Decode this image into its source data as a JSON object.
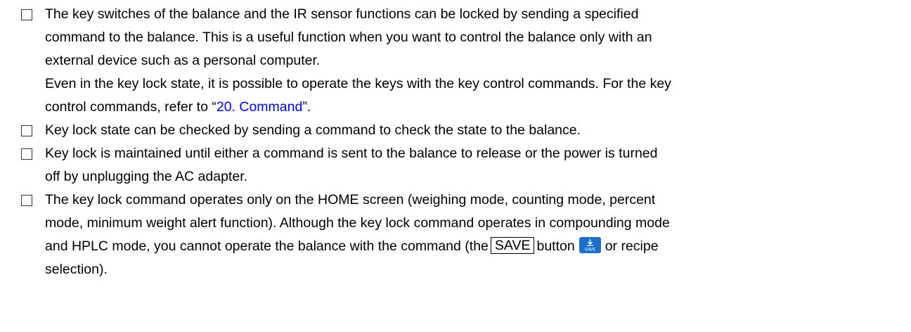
{
  "items": [
    {
      "lines": [
        "The key switches of the balance and the IR sensor functions can be locked by sending a specified",
        "command to the balance. This is a useful function when you want to control the balance only with an",
        "external device such as a personal computer.",
        "Even in the key lock state, it is possible to operate the keys with the key control commands. For the key"
      ],
      "last_line_prefix": "control commands, refer to “",
      "link_text": "20. Command",
      "last_line_suffix": "”."
    },
    {
      "lines": [
        "Key lock state can be checked by sending a command to check the state to the balance."
      ]
    },
    {
      "lines": [
        "Key lock is maintained until either a command is sent to the balance to release or the power is turned",
        "off by unplugging the AC adapter."
      ]
    },
    {
      "lines": [
        "The key lock command operates only on the HOME screen (weighing mode, counting mode, percent",
        "mode, minimum weight alert function). Although the key lock command operates in compounding mode"
      ],
      "line3_prefix": "and HPLC mode, you cannot operate the balance with the command (the",
      "key_label": "SAVE",
      "line3_mid": "button",
      "icon_name": "save-icon",
      "icon_text": "SAVE",
      "line3_suffix": "or recipe",
      "line4": "selection)."
    }
  ],
  "colors": {
    "link": "#0000ee",
    "icon_bg": "#1a6fcf"
  }
}
